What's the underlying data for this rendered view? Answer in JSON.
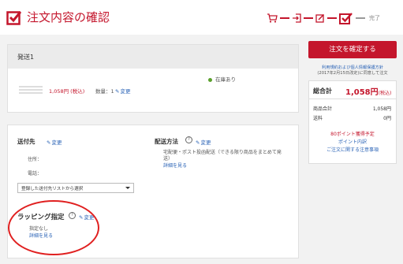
{
  "header": {
    "title": "注文内容の確認",
    "done_label": "完了"
  },
  "shipment": {
    "title": "発送1",
    "stock": "在庫あり",
    "price": "1,058円 (税込)",
    "qty": "数量：1",
    "edit": "変更"
  },
  "delivery": {
    "address_title": "送付先",
    "address_edit": "変更",
    "address_label": "住所：",
    "phone_label": "電話：",
    "address_select": "登録した送付先リストから選択",
    "method_title": "配送方法",
    "method_edit": "変更",
    "method_desc_1": "宅配便・ポスト投函配送（できる限り商品をまとめて発",
    "method_desc_2": "送）",
    "method_link": "詳細を見る"
  },
  "wrapping": {
    "title": "ラッピング指定",
    "edit": "変更",
    "value": "指定なし",
    "link": "詳細を見る"
  },
  "summary": {
    "confirm_button": "注文を確定する",
    "terms_1": "利用規約および個人情報保護方針",
    "terms_2": "(2017年2月15日改定)に同意して注文",
    "total_label": "総合計",
    "total_value": "1,058円",
    "total_tax": "(税込)",
    "subtotal_label": "商品合計",
    "subtotal_value": "1,058円",
    "shipping_label": "送料",
    "shipping_value": "0円",
    "points": "80ポイント獲得予定",
    "points_link": "ポイント内訳",
    "notes_link": "ご注文に関する注意事項"
  },
  "colors": {
    "accent": "#c4162c",
    "link": "#2a63b6",
    "annotation": "#e02020"
  }
}
